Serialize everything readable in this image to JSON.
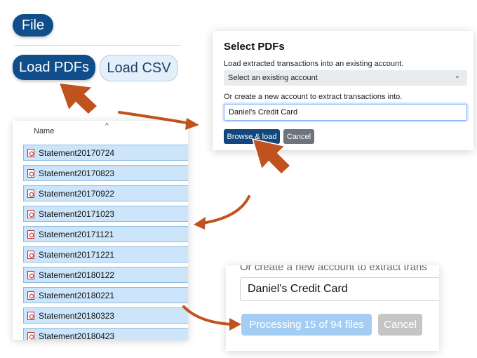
{
  "toolbar": {
    "file_label": "File",
    "load_pdfs_label": "Load PDFs",
    "load_csv_label": "Load CSV"
  },
  "file_list": {
    "column_header": "Name",
    "sort_caret": "^",
    "files": [
      "Statement20170724",
      "Statement20170823",
      "Statement20170922",
      "Statement20171023",
      "Statement20171121",
      "Statement20171221",
      "Statement20180122",
      "Statement20180221",
      "Statement20180323",
      "Statement20180423"
    ]
  },
  "dialog": {
    "title": "Select PDFs",
    "existing_label": "Load extracted transactions into an existing account.",
    "select_placeholder": "Select an existing account",
    "select_chevron": "⌄",
    "new_label": "Or create a new account to extract transactions into.",
    "new_account_value": "Daniel's Credit Card",
    "browse_label": "Browse & load",
    "cancel_label": "Cancel"
  },
  "processing": {
    "cut_label": "Or create a new account to extract trans",
    "account_value": "Daniel's Credit Card",
    "progress_label": "Processing 15 of 94 files",
    "cancel_label": "Cancel"
  },
  "colors": {
    "primary": "#0f4e8a",
    "arrow": "#c0531d",
    "selection": "#cce5fa"
  }
}
